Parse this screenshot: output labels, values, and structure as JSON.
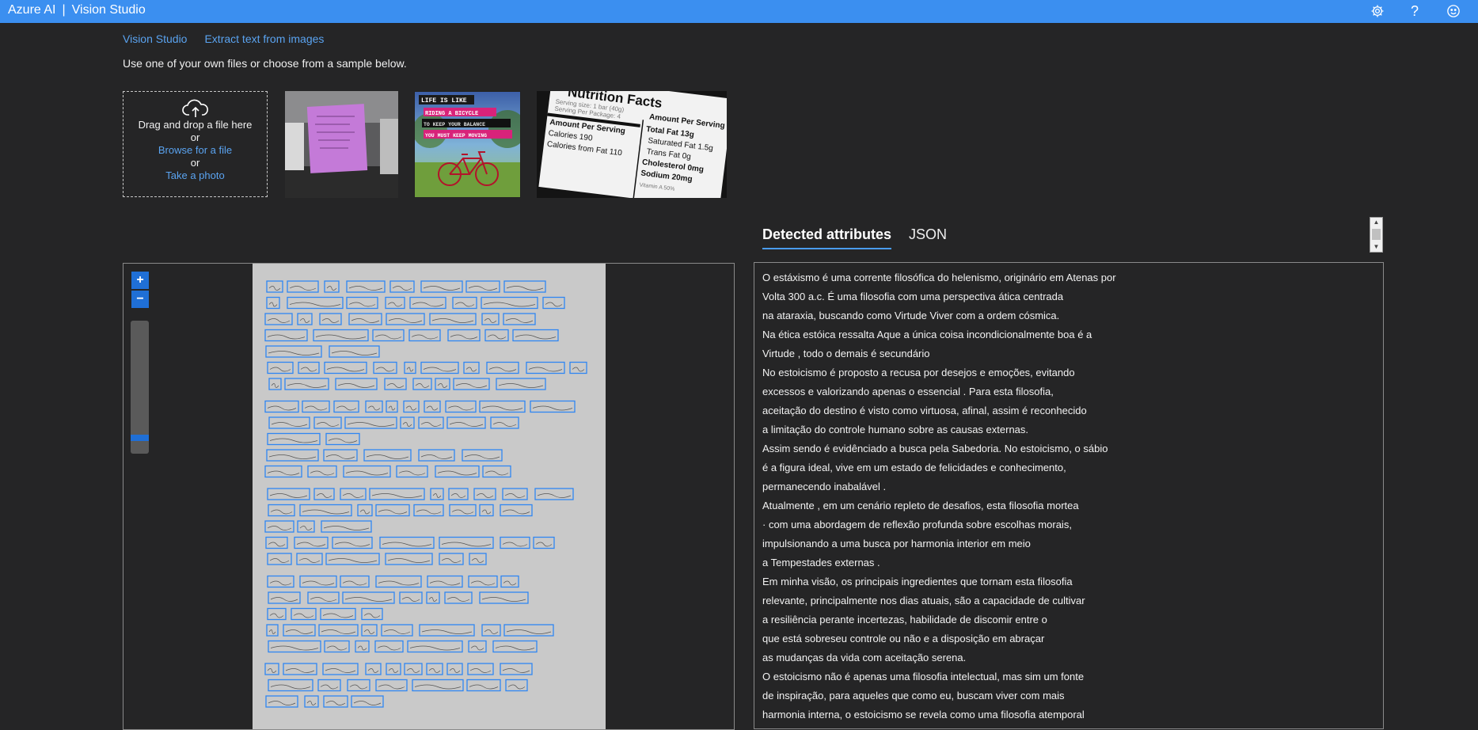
{
  "app": {
    "brand_left": "Azure AI",
    "separator": "|",
    "brand_right": "Vision Studio"
  },
  "topbar_icons": [
    "gear-icon",
    "help-icon",
    "smiley-feedback-icon"
  ],
  "breadcrumb": {
    "home": "Vision Studio",
    "current": "Extract text from images"
  },
  "instruction": "Use one of your own files or choose from a sample below.",
  "uploader": {
    "drag_text": "Drag and drop a file here",
    "or_1": "or",
    "browse": "Browse for a file",
    "or_2": "or",
    "photo": "Take a photo"
  },
  "samples": [
    {
      "name": "sticky-note-sample"
    },
    {
      "name": "bicycle-poster-sample",
      "lines": [
        "LIFE IS LIKE",
        "RIDING A BICYCLE",
        "TO KEEP YOUR BALANCE",
        "YOU MUST KEEP MOVING"
      ]
    },
    {
      "name": "nutrition-facts-sample",
      "lines": [
        "Nutrition Facts",
        "Serving size: 1 bar (40g)",
        "Serving Per Package: 4",
        "Amount Per Serving",
        "Total Fat 13g",
        "Amount Per Serving",
        "Saturated Fat 1.5g",
        "Calories 190",
        "Trans Fat 0g",
        "Calories from Fat 110",
        "Cholesterol 0mg",
        "Sodium 20mg",
        "Vitamin A 50%"
      ]
    }
  ],
  "tabs": {
    "detected": "Detected attributes",
    "json": "JSON"
  },
  "viewer": {
    "zoom_in": "+",
    "zoom_out": "−",
    "zoom_level": 0.9
  },
  "colors": {
    "topbar": "#3b8ff0",
    "accent": "#4a9cf2",
    "link": "#5aa3f0",
    "box": "#2f86f2",
    "background": "#252526"
  },
  "extracted_lines": [
    "O estáxismo é uma corrente filosófica do helenismo, originário em Atenas por",
    "Volta 300 a.c. É uma filosofia com uma perspectiva ática centrada",
    "na ataraxia, buscando como Virtude Viver com a ordem cósmica.",
    "Na ética estóica ressalta Aque a única coisa incondicionalmente boa é a",
    "Virtude , todo o demais é secundário",
    "No estoicismo é proposto a recusa por desejos e emoções, evitando",
    "excessos e valorizando apenas o essencial . Para esta filosofia,",
    "aceitação do destino é visto como virtuosa, afinal, assim é reconhecido",
    "a limitação do controle humano sobre as causas externas.",
    "Assim sendo é evidênciado a busca pela Sabedoria. No estoicismo, o sábio",
    "é a figura ideal, vive em um estado de felicidades e conhecimento,",
    "permanecendo inabalável .",
    "Atualmente , em um cenário repleto de desafios, esta filosofia mortea",
    "· com uma abordagem de reflexão profunda sobre escolhas morais,",
    "impulsionando a uma busca por harmonia interior em meio",
    "a Tempestades externas .",
    "Em minha visão, os principais ingredientes que tornam esta filosofia",
    "relevante, principalmente nos dias atuais, são a capacidade de cultivar",
    "a resiliência perante incertezas, habilidade de discomir entre o",
    "que está sobreseu controle ou não e a disposição em abraçar",
    "as mudanças da vida com aceitação serena.",
    "O estoicismo não é apenas uma filosofia intelectual, mas sim um fonte",
    "de inspiração, para aqueles que como eu, buscam viver com mais",
    "harmonia interna, o estoicismo se revela como uma filosofia atemporal"
  ]
}
